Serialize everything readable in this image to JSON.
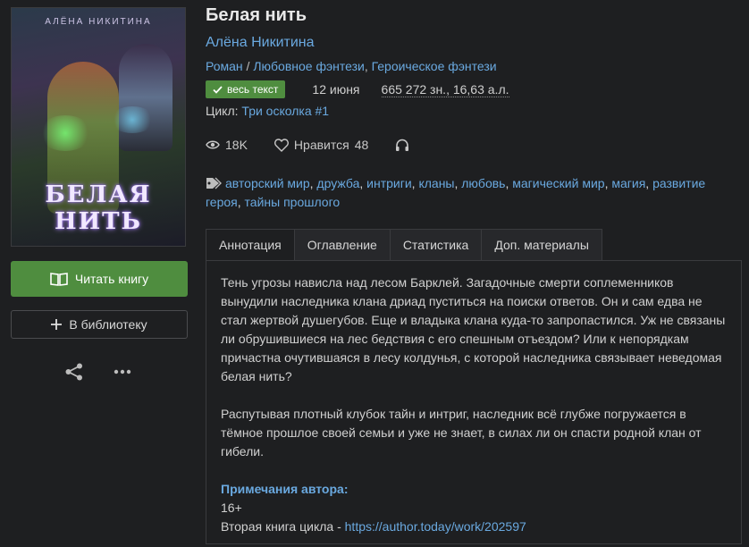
{
  "cover": {
    "author": "АЛЁНА НИКИТИНА",
    "title": "БЕЛАЯ НИТЬ"
  },
  "actions": {
    "read_label": "Читать книгу",
    "library_label": "В библиотеку"
  },
  "book": {
    "title": "Белая нить",
    "author": "Алёна Никитина",
    "genres": [
      "Роман",
      "Любовное фэнтези",
      "Героическое фэнтези"
    ],
    "status_badge": "весь текст",
    "date": "12 июня",
    "size": "665 272 зн., 16,63 а.л.",
    "cycle_label": "Цикл:",
    "cycle_name": "Три осколка #1"
  },
  "stats": {
    "views": "18K",
    "likes_label": "Нравится",
    "likes_count": "48"
  },
  "tags": [
    "авторский мир",
    "дружба",
    "интриги",
    "кланы",
    "любовь",
    "магический мир",
    "магия",
    "развитие героя",
    "тайны прошлого"
  ],
  "tabs": [
    {
      "label": "Аннотация",
      "active": true
    },
    {
      "label": "Оглавление",
      "active": false
    },
    {
      "label": "Статистика",
      "active": false
    },
    {
      "label": "Доп. материалы",
      "active": false
    }
  ],
  "annotation": {
    "paragraph1": "Тень угрозы нависла над лесом Барклей. Загадочные смерти соплеменников вынудили наследника клана дриад пуститься на поиски ответов. Он и сам едва не стал жертвой душегубов. Еще и владыка клана куда-то запропастился. Уж не связаны ли обрушившиеся на лес бедствия с его спешным отъездом? Или к непорядкам причастна очутившаяся в лесу колдунья, с которой наследника связывает неведомая белая нить?",
    "paragraph2": "Распутывая плотный клубок тайн и интриг, наследник всё глубже погружается в тёмное прошлое своей семьи и уже не знает, в силах ли он спасти родной клан от гибели.",
    "notes_title": "Примечания автора:",
    "age": "16+",
    "next_book_label": "Вторая книга цикла - ",
    "next_book_link": "https://author.today/work/202597"
  },
  "colors": {
    "background": "#1e1f21",
    "link": "#6aa9e0",
    "accent_green": "#4f8d3f"
  }
}
